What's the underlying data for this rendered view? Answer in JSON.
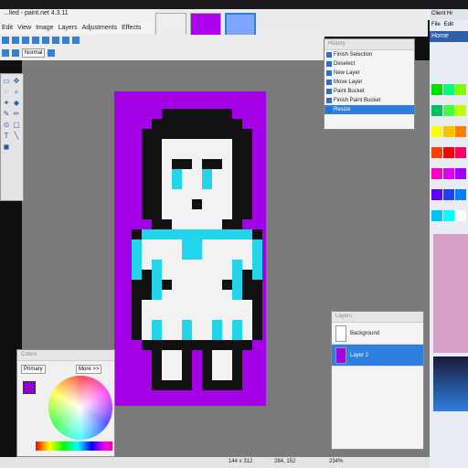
{
  "window": {
    "title": "...lled - paint.net 4.3.11"
  },
  "menu": [
    "Edit",
    "View",
    "Image",
    "Layers",
    "Adjustments",
    "Effects"
  ],
  "toolbar": {
    "blend_mode": "Normal"
  },
  "history": {
    "title": "History",
    "items": [
      {
        "label": "Finish Selection",
        "active": false
      },
      {
        "label": "Deselect",
        "active": false
      },
      {
        "label": "New Layer",
        "active": false
      },
      {
        "label": "Move Layer",
        "active": false
      },
      {
        "label": "Paint Bucket",
        "active": false
      },
      {
        "label": "Finish Paint Bucket",
        "active": false
      },
      {
        "label": "Resize",
        "active": true
      }
    ]
  },
  "layers": {
    "title": "Layers",
    "items": [
      {
        "label": "Background",
        "active": false
      },
      {
        "label": "Layer 2",
        "active": true
      }
    ]
  },
  "colors_panel": {
    "title": "Colors",
    "primary": "Primary",
    "more": "More >>"
  },
  "browser": {
    "tab_label": "Client Hr",
    "file_label": "File",
    "edit_label": "Edit",
    "home_label": "Home"
  },
  "status": {
    "image_size": "144 x 312",
    "cursor": "284, 152",
    "zoom": "234%"
  },
  "colors": {
    "canvas_bg": "#a400e8",
    "accent": "#2f7fe0",
    "primary": "#8d00d0"
  }
}
